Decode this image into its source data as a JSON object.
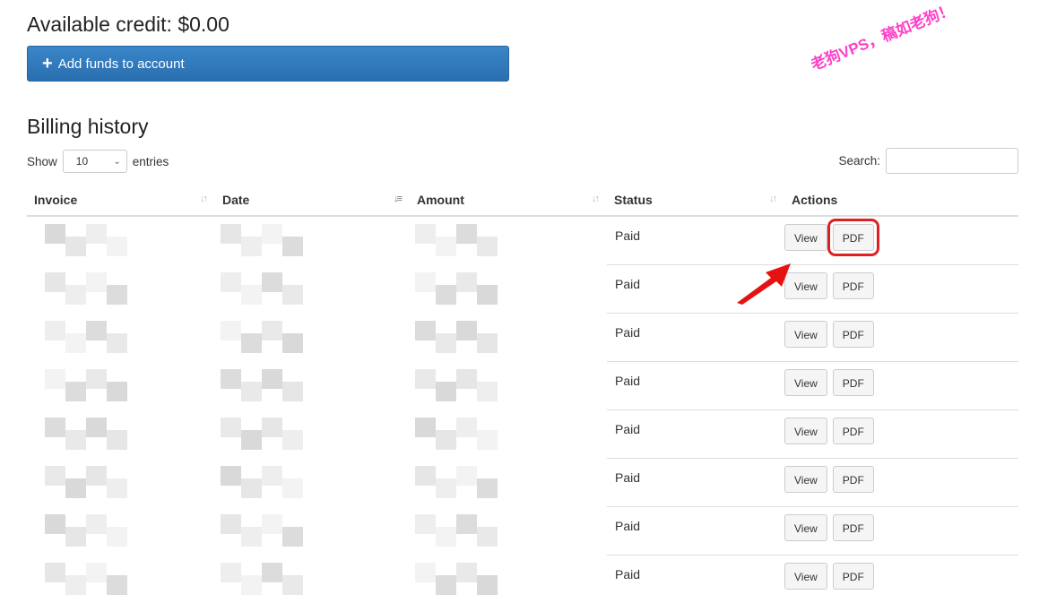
{
  "credit": {
    "title": "Available credit: $0.00"
  },
  "add_funds": {
    "label": "Add funds to account"
  },
  "billing": {
    "title": "Billing history"
  },
  "length": {
    "prefix": "Show",
    "value": "10",
    "suffix": "entries"
  },
  "search": {
    "label": "Search:",
    "value": ""
  },
  "table": {
    "headers": [
      "Invoice",
      "Date",
      "Amount",
      "Status",
      "Actions"
    ],
    "rows": [
      {
        "status": "Paid",
        "view": "View",
        "pdf": "PDF"
      },
      {
        "status": "Paid",
        "view": "View",
        "pdf": "PDF"
      },
      {
        "status": "Paid",
        "view": "View",
        "pdf": "PDF"
      },
      {
        "status": "Paid",
        "view": "View",
        "pdf": "PDF"
      },
      {
        "status": "Paid",
        "view": "View",
        "pdf": "PDF"
      },
      {
        "status": "Paid",
        "view": "View",
        "pdf": "PDF"
      },
      {
        "status": "Paid",
        "view": "View",
        "pdf": "PDF"
      },
      {
        "status": "Paid",
        "view": "View",
        "pdf": "PDF"
      }
    ]
  },
  "watermark": "老狗VPS，稿如老狗！",
  "colors": {
    "primary_button": "#2a6fb0",
    "highlight": "#e02020",
    "watermark": "#ff3fc8"
  }
}
